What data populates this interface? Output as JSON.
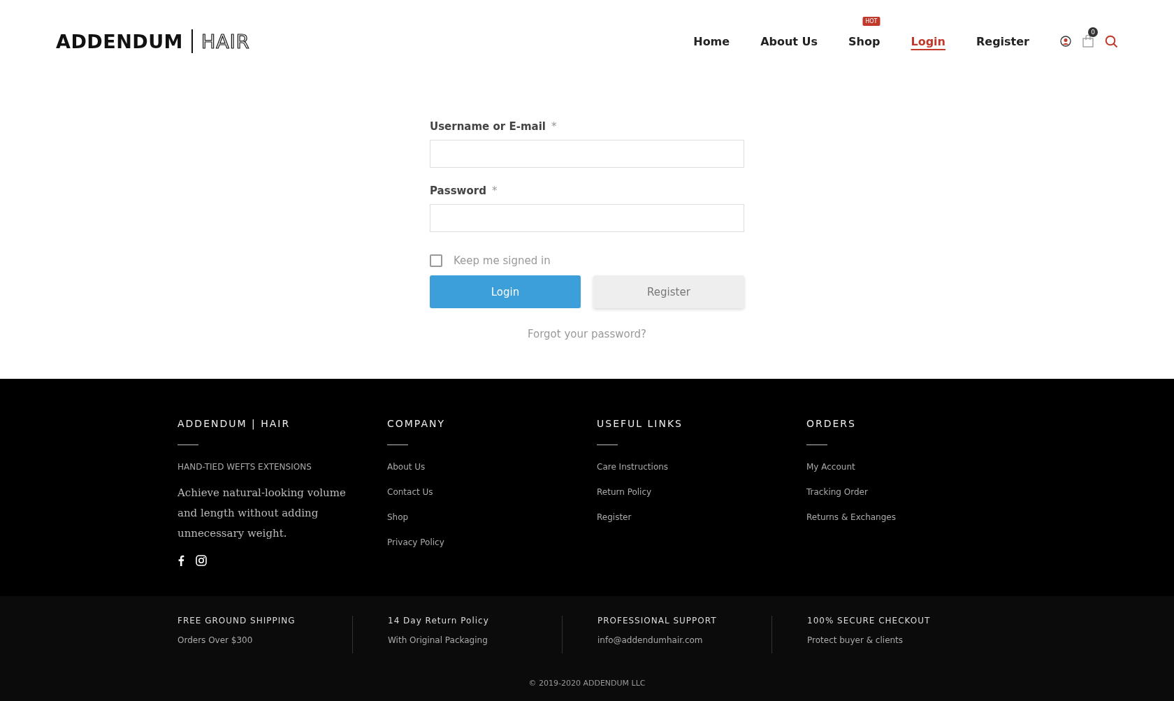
{
  "header": {
    "logo": {
      "brand": "ADDENDUM",
      "product": "HAIR"
    },
    "nav": [
      {
        "label": "Home",
        "selected": false
      },
      {
        "label": "About Us",
        "selected": false
      },
      {
        "label": "Shop",
        "selected": false,
        "badge": "HOT"
      },
      {
        "label": "Login",
        "selected": true
      },
      {
        "label": "Register",
        "selected": false
      }
    ],
    "cart_count": "0"
  },
  "form": {
    "fields": [
      {
        "label": "Username or E-mail",
        "required": "*"
      },
      {
        "label": "Password",
        "required": "*"
      }
    ],
    "remember": {
      "label": "Keep me signed in",
      "checked": false
    },
    "buttons": [
      {
        "label": "Login",
        "kind": "primary"
      },
      {
        "label": "Register",
        "kind": "secondary"
      }
    ],
    "forgot": "Forgot your password?"
  },
  "footer": {
    "about": {
      "heading": "ADDENDUM | HAIR",
      "tagline": "HAND-TIED WEFTS EXTENSIONS",
      "text": "Achieve natural-looking volume and length without adding unnecessary weight."
    },
    "columns": [
      {
        "heading": "COMPANY",
        "links": [
          "About Us",
          "Contact Us",
          "Shop",
          "Privacy Policy"
        ]
      },
      {
        "heading": "USEFUL LINKS",
        "links": [
          "Care Instructions",
          "Return Policy",
          "Register"
        ]
      },
      {
        "heading": "ORDERS",
        "links": [
          "My Account",
          "Tracking Order",
          "Returns & Exchanges"
        ]
      }
    ],
    "features": [
      {
        "title": "FREE GROUND SHIPPING",
        "text": "Orders Over $300"
      },
      {
        "title": "14 Day Return Policy",
        "text": "With Original Packaging"
      },
      {
        "title": "PROFESSIONAL SUPPORT",
        "text": "info@addendumhair.com"
      },
      {
        "title": "100% SECURE CHECKOUT",
        "text": "Protect buyer & clients"
      }
    ],
    "copyright": "© 2019-2020 ADDENDUM LLC"
  }
}
